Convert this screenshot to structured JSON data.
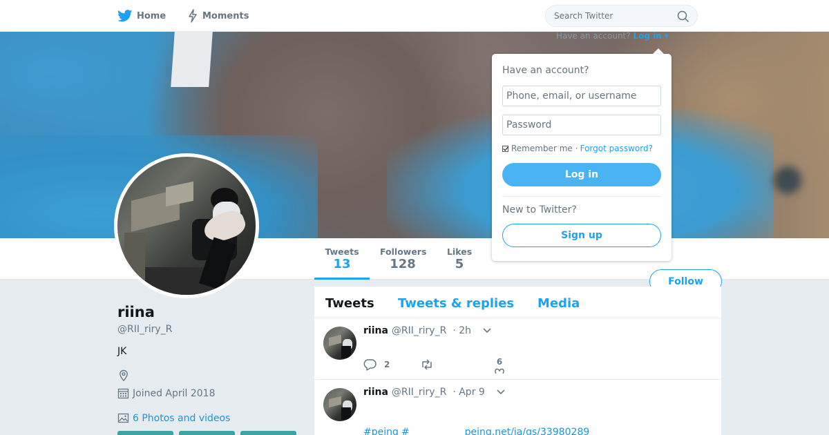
{
  "nav": {
    "home_label": "Home",
    "moments_label": "Moments",
    "search_placeholder": "Search Twitter",
    "have_account_text": "Have an account?",
    "login_link": "Log in",
    "login_caret": "▾"
  },
  "profile": {
    "name": "riina",
    "handle": "@RII_riry_R",
    "bio": "JK",
    "joined": "Joined April 2018",
    "photos_link": "6 Photos and videos",
    "follow_label": "Follow"
  },
  "stats": {
    "tweets_label": "Tweets",
    "tweets_value": "13",
    "followers_label": "Followers",
    "followers_value": "128",
    "likes_label": "Likes",
    "likes_value": "5"
  },
  "timeline": {
    "tabs": [
      {
        "label": "Tweets"
      },
      {
        "label": "Tweets & replies"
      },
      {
        "label": "Media"
      }
    ],
    "tweets": [
      {
        "name": "riina",
        "handle": "@RII_riry_R",
        "time": "· 2h",
        "reply_count": "2",
        "like_count": "6"
      },
      {
        "name": "riina",
        "handle": "@RII_riry_R",
        "time": "· Apr 9",
        "text_parts": [
          "#peing",
          "#",
          "",
          "peing.net/ja/qs/33980289"
        ]
      }
    ]
  },
  "login_dropdown": {
    "title": "Have an account?",
    "username_placeholder": "Phone, email, or username",
    "password_placeholder": "Password",
    "remember_label": "Remember me",
    "separator": "·",
    "forgot_link": "Forgot password?",
    "login_button": "Log in",
    "new_text": "New to Twitter?",
    "signup_button": "Sign up"
  },
  "colors": {
    "accent": "#1da1f2",
    "login_button_bg": "#4ab3f4",
    "background": "#e6ecf0"
  }
}
